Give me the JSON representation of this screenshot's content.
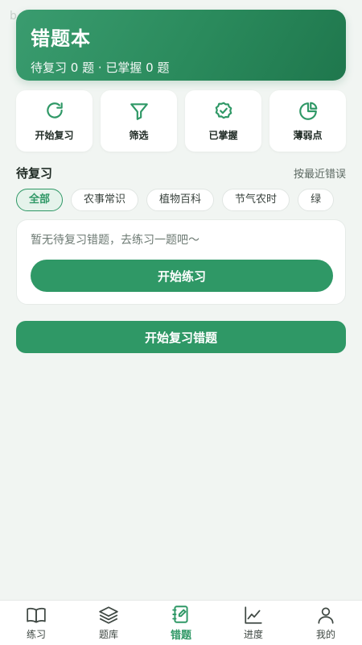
{
  "status_mark": "b",
  "hero": {
    "title": "错题本",
    "subtitle": "待复习 0 题 · 已掌握 0 题"
  },
  "quick_actions": [
    {
      "label": "开始复习",
      "icon": "refresh-icon"
    },
    {
      "label": "筛选",
      "icon": "filter-icon"
    },
    {
      "label": "已掌握",
      "icon": "check-badge-icon"
    },
    {
      "label": "薄弱点",
      "icon": "pie-chart-icon"
    }
  ],
  "section": {
    "title": "待复习",
    "sort": "按最近错误"
  },
  "chips": [
    {
      "label": "全部",
      "active": true
    },
    {
      "label": "农事常识"
    },
    {
      "label": "植物百科"
    },
    {
      "label": "节气农时"
    },
    {
      "label": "绿"
    }
  ],
  "empty": {
    "text": "暂无待复习错题，去练习一题吧～",
    "button": "开始练习"
  },
  "review_button": "开始复习错题",
  "tabs": [
    {
      "label": "练习",
      "icon": "book-open-icon"
    },
    {
      "label": "题库",
      "icon": "layers-icon"
    },
    {
      "label": "错题",
      "icon": "notebook-edit-icon",
      "active": true
    },
    {
      "label": "进度",
      "icon": "line-chart-icon"
    },
    {
      "label": "我的",
      "icon": "user-icon"
    }
  ],
  "colors": {
    "primary": "#2f9866",
    "hero_dark": "#1f774d",
    "background": "#f1f5f2",
    "tab_inactive": "#3f4843"
  }
}
